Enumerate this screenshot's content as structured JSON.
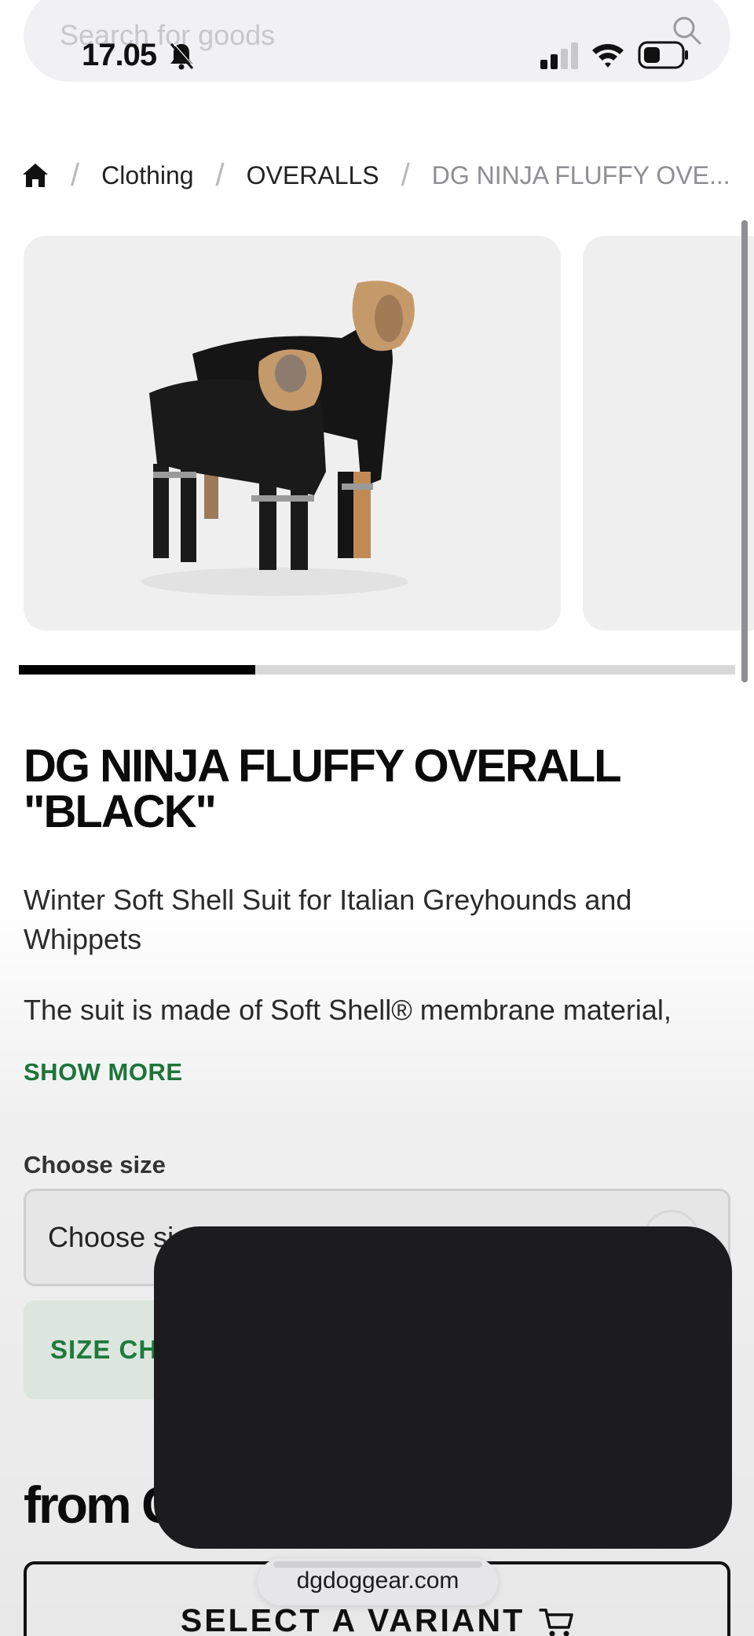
{
  "search": {
    "placeholder": "Search for goods"
  },
  "status_bar": {
    "time": "17.05"
  },
  "breadcrumb": {
    "items": [
      "Clothing",
      "OVERALLS"
    ],
    "current": "DG NINJA FLUFFY OVE..."
  },
  "gallery": {
    "progress": 0.33
  },
  "product": {
    "title_line1": "DG NINJA FLUFFY OVERALL",
    "title_line2": "\"BLACK\"",
    "subtitle": "Winter Soft Shell Suit for Italian Greyhounds and Whippets",
    "description": "The suit is made of Soft Shell® membrane material,",
    "show_more": "SHOW MORE"
  },
  "size": {
    "label": "Choose size",
    "select_value": "Choose si",
    "chart_button": "SIZE CH"
  },
  "price": {
    "text": "from C"
  },
  "cta": {
    "select_variant": "SELECT A VARIANT"
  },
  "browser": {
    "url": "dgdoggear.com"
  },
  "colors": {
    "accent_green": "#1e7a3c",
    "overlay": "#1c1c1e",
    "product_black": "#0b0b0b"
  }
}
